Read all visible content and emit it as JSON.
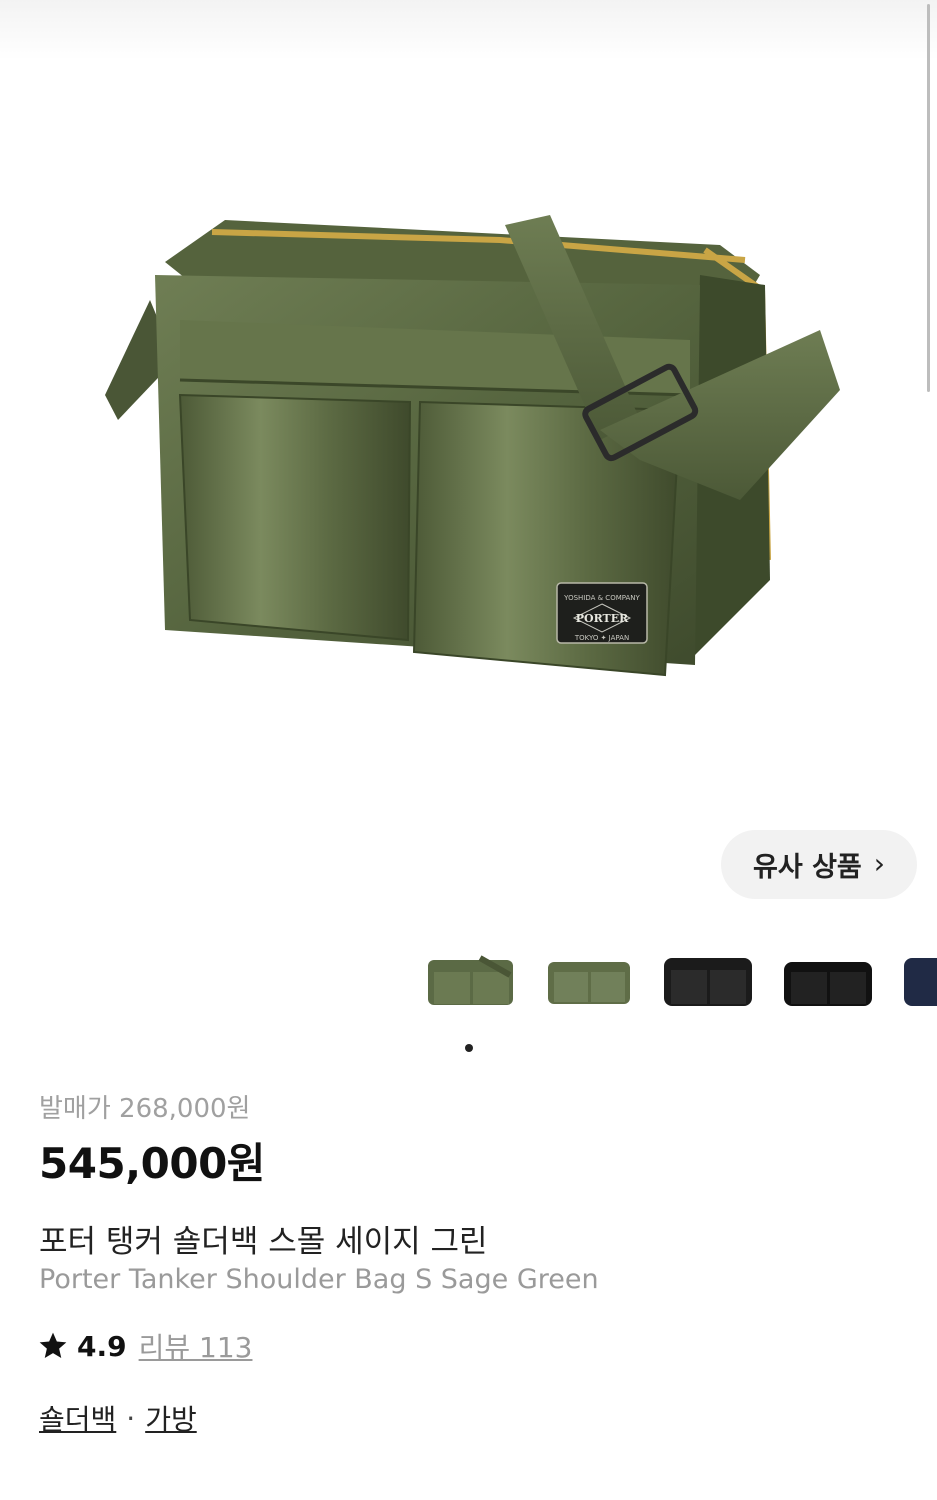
{
  "product": {
    "release_price": "발매가 268,000원",
    "price": "545,000원",
    "name_ko": "포터 탱커 숄더백 스몰 세이지 그린",
    "name_en": "Porter Tanker Shoulder Bag S Sage Green",
    "rating": "4.9",
    "review_link": "리뷰 113",
    "category": [
      "숄더백",
      "가방"
    ],
    "category_separator": "·",
    "colors": {
      "sage": "#5b6a45",
      "black": "#1b1b1b",
      "navy": "#202a45"
    }
  },
  "hero": {
    "label_top": "YOSHIDA & COMPANY",
    "label_brand": "PORTER",
    "label_bottom": "TOKYO ✦ JAPAN"
  },
  "similar_button": {
    "label": "유사 상품",
    "icon": "chevron-right-icon"
  },
  "carousel": {
    "thumbnails": [
      "sage",
      "sage",
      "black",
      "black",
      "navy"
    ],
    "active_index": 0
  }
}
